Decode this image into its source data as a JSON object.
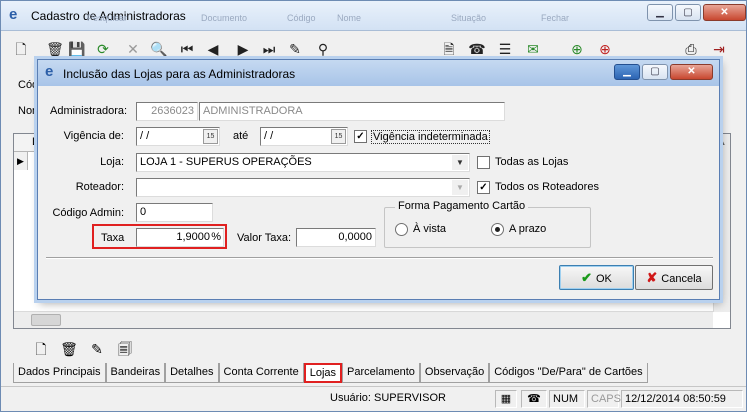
{
  "main_window": {
    "title": "Cadastro de Administradoras",
    "ghost_text": [
      "Pesquisar",
      "Documento",
      "Código",
      "Nome",
      "Situação",
      "Fechar"
    ],
    "side_labels": [
      "Códi",
      "Nom"
    ],
    "grid_header_cell": "Lo"
  },
  "toolbar": {
    "icons": [
      "new-icon",
      "delete-icon",
      "save-icon",
      "refresh-icon",
      "cancel-icon",
      "search-icon",
      "first-icon",
      "prev-icon",
      "next-icon",
      "last-icon",
      "filter-icon",
      "binoculars-icon",
      "add-doc-icon",
      "phone-icon",
      "list-icon",
      "chat-icon",
      "green-circle-icon",
      "red-circle-icon",
      "print-icon",
      "exit-icon"
    ]
  },
  "tabs": [
    {
      "label": "Dados Principais",
      "active": false
    },
    {
      "label": "Bandeiras",
      "active": false
    },
    {
      "label": "Detalhes",
      "active": false
    },
    {
      "label": "Conta Corrente",
      "active": false
    },
    {
      "label": "Lojas",
      "active": true
    },
    {
      "label": "Parcelamento",
      "active": false
    },
    {
      "label": "Observação",
      "active": false
    },
    {
      "label": "Códigos \"De/Para\" de Cartões",
      "active": false
    }
  ],
  "statusbar": {
    "user": "Usuário: SUPERVISOR",
    "num": "NUM",
    "caps": "CAPS",
    "datetime": "12/12/2014 08:50:59"
  },
  "dialog": {
    "title": "Inclusão das Lojas para as Administradoras",
    "administradora_label": "Administradora:",
    "administradora_code": "2636023",
    "administradora_name": "ADMINISTRADORA",
    "vigencia_label": "Vigência de:",
    "vigencia_de": "/ /",
    "ate_label": "até",
    "vigencia_ate": "/ /",
    "cal_label": "15",
    "vigencia_indeterminada_label": "Vigência indeterminada",
    "vigencia_indeterminada_checked": true,
    "loja_label": "Loja:",
    "loja_value": "LOJA 1 - SUPERUS OPERAÇÕES",
    "todas_lojas_label": "Todas as Lojas",
    "todas_lojas_checked": false,
    "roteador_label": "Roteador:",
    "roteador_value": "",
    "todos_roteadores_label": "Todos os Roteadores",
    "todos_roteadores_checked": true,
    "codigo_admin_label": "Código Admin:",
    "codigo_admin_value": "0",
    "taxa_label": "Taxa",
    "taxa_value": "1,9000",
    "taxa_unit": "%",
    "valor_taxa_label": "Valor Taxa:",
    "valor_taxa_value": "0,0000",
    "forma_pagamento_title": "Forma Pagamento Cartão",
    "a_vista_label": "À vista",
    "a_prazo_label": "A prazo",
    "selected_payment": "A prazo",
    "ok_label": "OK",
    "cancel_label": "Cancela"
  },
  "colors": {
    "highlight": "#e02020",
    "title_bar": "#c5d9f1",
    "ok_icon": "#1a9a1a",
    "cancel_icon": "#d01818"
  }
}
